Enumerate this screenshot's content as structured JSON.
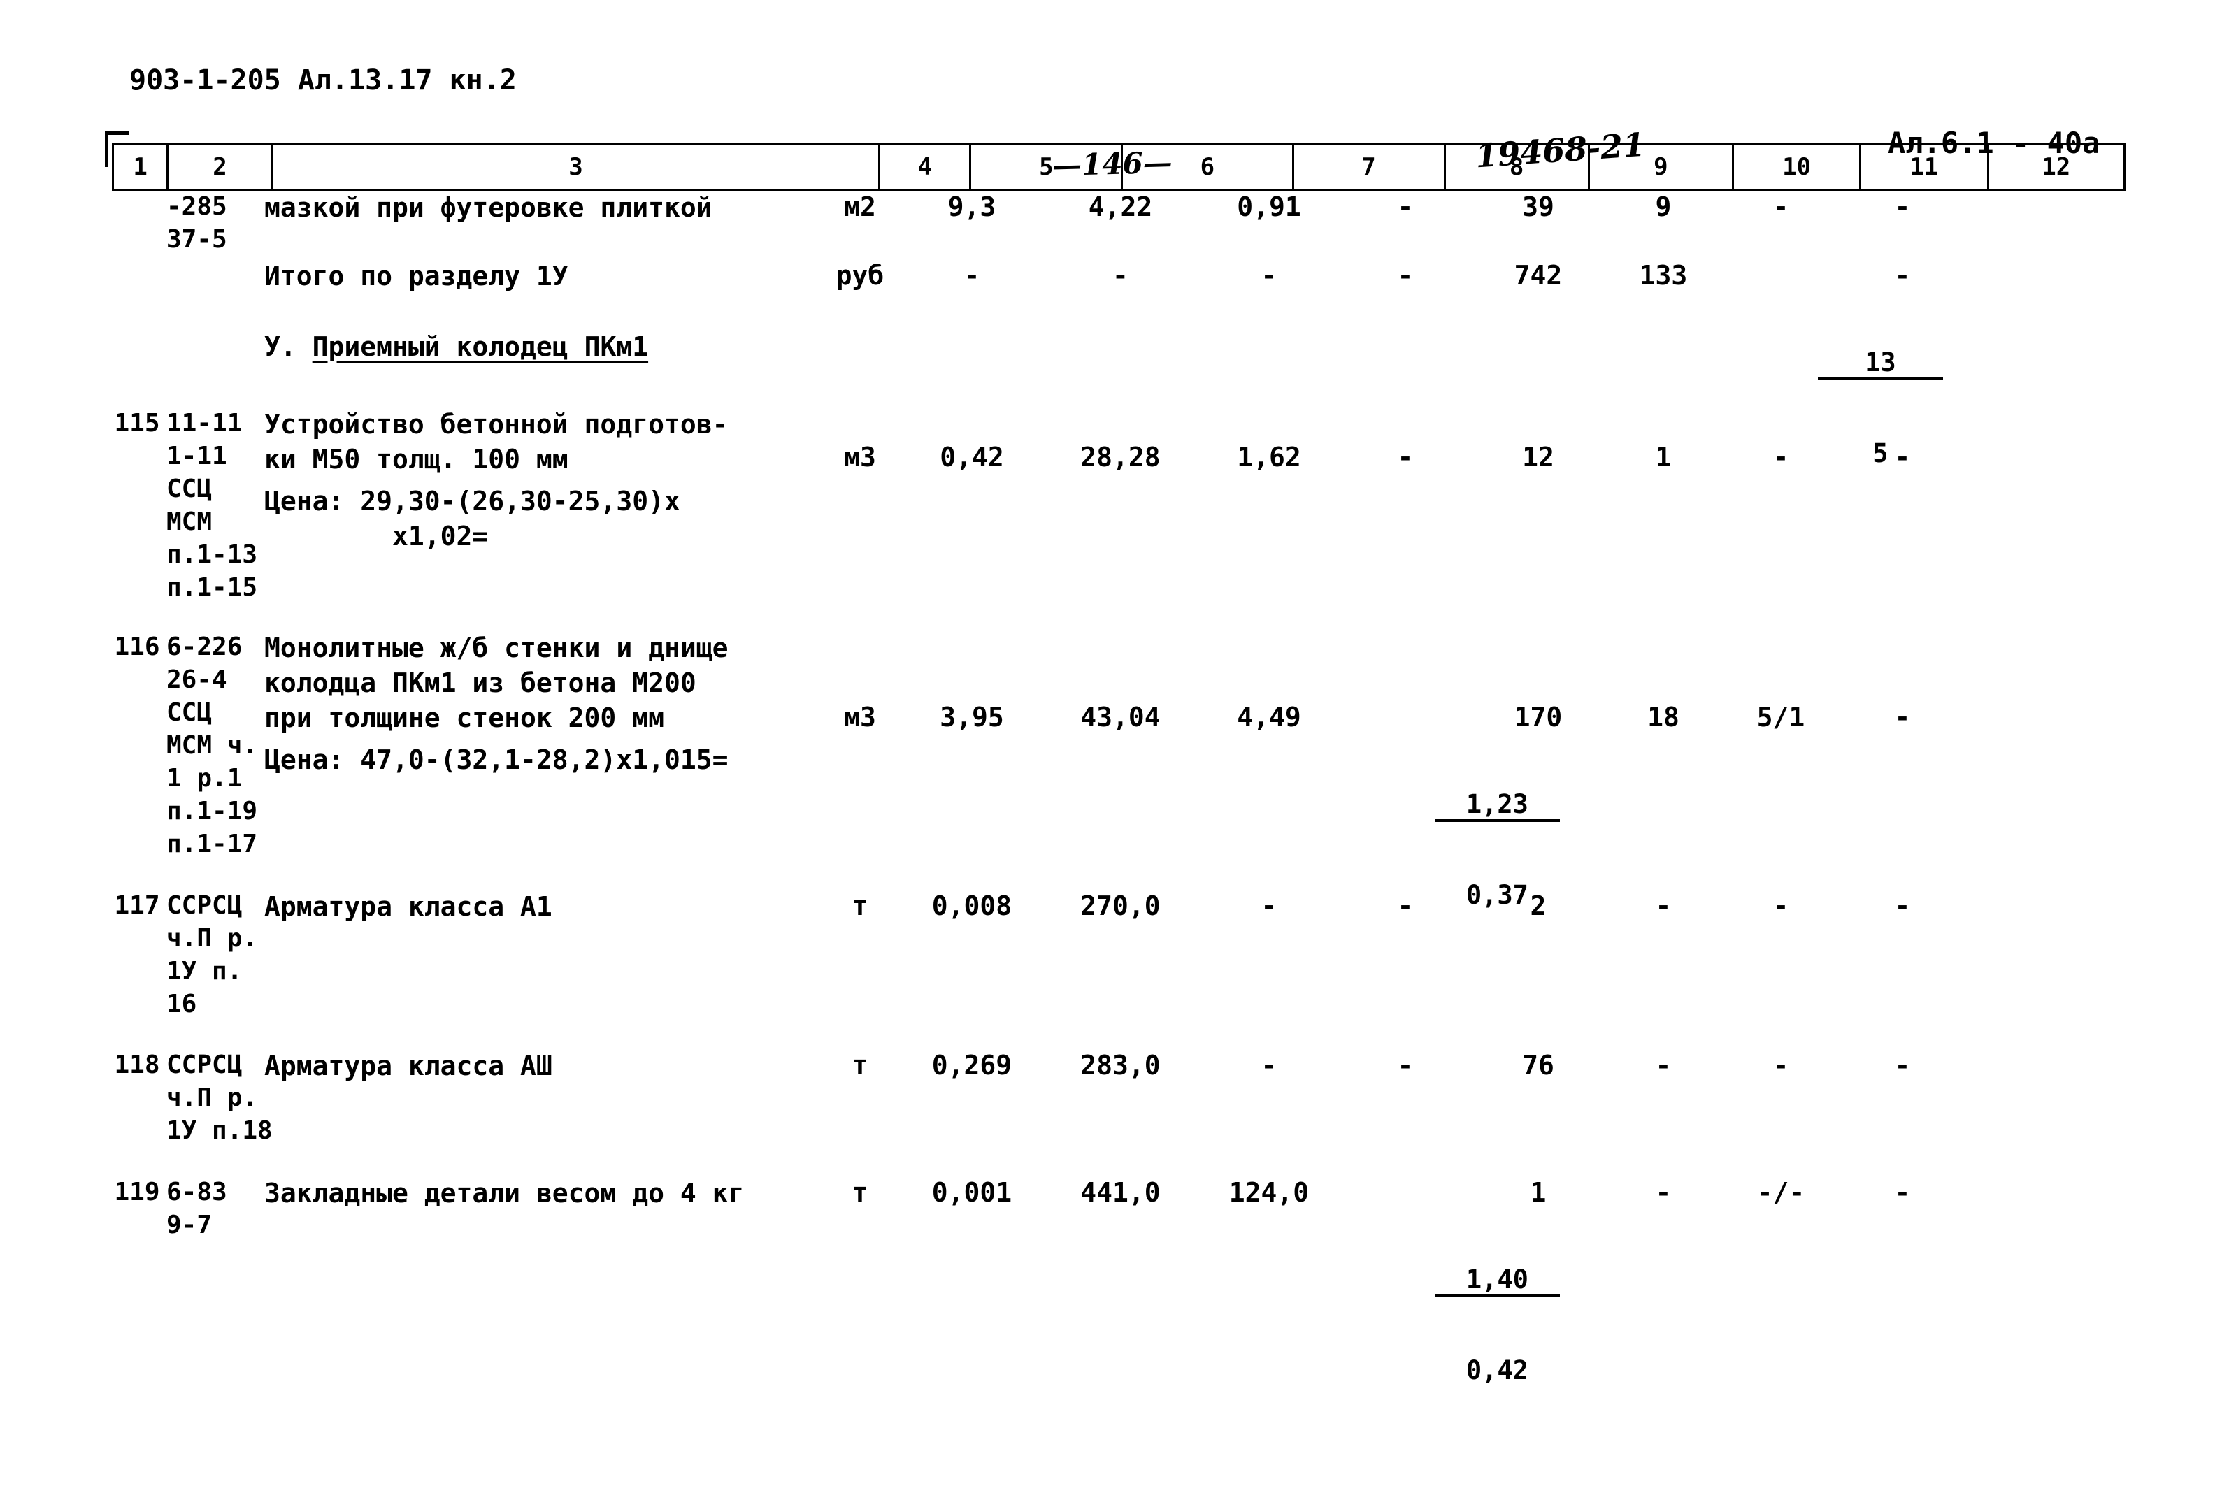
{
  "header": {
    "doc_code": "903-1-205 Ал.13.17 кн.2",
    "page_number": "—146—",
    "stamp": "19468-21",
    "album_ref": "Ал.6.1 - 40а"
  },
  "table": {
    "column_numbers": [
      "1",
      "2",
      "3",
      "4",
      "5",
      "6",
      "7",
      "8",
      "9",
      "10",
      "11",
      "12"
    ]
  },
  "rows": [
    {
      "no": "",
      "code": "-285\n37-5",
      "description": "мазкой при футеровке плиткой",
      "unit": "м2",
      "c5": "9,3",
      "c6": "4,22",
      "c7": "0,91",
      "c8": "-",
      "c9": "39",
      "c10": "9",
      "c11": "-",
      "c12": "-"
    },
    {
      "no": "",
      "code": "",
      "description": "Итого по разделу 1У",
      "unit": "руб",
      "c5": "-",
      "c6": "-",
      "c7": "-",
      "c8": "-",
      "c9": "742",
      "c10": "133",
      "c11_top": "13",
      "c11_bot": "5",
      "c12": "-"
    },
    {
      "no": "115",
      "code": "11-11\n1-11\nССЦ\nМСМ\nп.1-13\nп.1-15",
      "description": "Устройство бетонной подготов-\nки М50 толщ. 100 мм",
      "price_note": "Цена: 29,30-(26,30-25,30)х\n        х1,02=",
      "unit": "м3",
      "c5": "0,42",
      "c6": "28,28",
      "c7": "1,62",
      "c8": "-",
      "c9": "12",
      "c10": "1",
      "c11": "-",
      "c12": "-"
    },
    {
      "no": "116",
      "code": "6-226\n26-4\nССЦ\nМСМ ч.\n1 р.1\nп.1-19\nп.1-17",
      "description": "Монолитные ж/б стенки и днище\nколодца ПКм1 из бетона М200\nпри толщине стенок 200 мм",
      "price_note": "Цена: 47,0-(32,1-28,2)х1,015=",
      "unit": "м3",
      "c5": "3,95",
      "c6": "43,04",
      "c7": "4,49",
      "c8_top": "1,23",
      "c8_bot": "0,37",
      "c9": "170",
      "c10": "18",
      "c11": "5/1",
      "c12": "-"
    },
    {
      "no": "117",
      "code": "ССРСЦ\nч.П р.\n1У п.\n16",
      "description": "Арматура класса А1",
      "unit": "т",
      "c5": "0,008",
      "c6": "270,0",
      "c7": "-",
      "c8": "-",
      "c9": "2",
      "c10": "-",
      "c11": "-",
      "c12": "-"
    },
    {
      "no": "118",
      "code": "ССРСЦ\nч.П р.\n1У п.18",
      "description": "Арматура класса АШ",
      "unit": "т",
      "c5": "0,269",
      "c6": "283,0",
      "c7": "-",
      "c8": "-",
      "c9": "76",
      "c10": "-",
      "c11": "-",
      "c12": "-"
    },
    {
      "no": "119",
      "code": "6-83\n9-7",
      "description": "Закладные детали весом до 4 кг",
      "unit": "т",
      "c5": "0,001",
      "c6": "441,0",
      "c7": "124,0",
      "c8_top": "1,40",
      "c8_bot": "0,42",
      "c9": "1",
      "c10": "-",
      "c11": "-/-",
      "c12": "-"
    }
  ],
  "section_heading": {
    "prefix": "У. ",
    "title": "Приемный колодец ПКм1"
  }
}
